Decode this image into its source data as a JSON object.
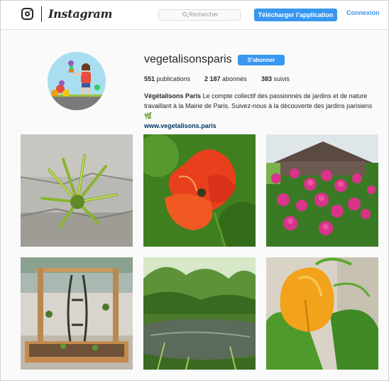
{
  "header": {
    "brand": "Instagram",
    "search_placeholder": "Rechercher",
    "download_label": "Télécharger l'application",
    "login_label": "Connexion"
  },
  "profile": {
    "username": "vegetalisonsparis",
    "follow_label": "S'abonner",
    "stats": {
      "posts_count": "551",
      "posts_label": "publications",
      "followers_count": "2 187",
      "followers_label": "abonnés",
      "following_count": "383",
      "following_label": "suivis"
    },
    "bio_name": "Végétalisons Paris",
    "bio_text": "Le compte collectif des passionnés de jardins et de nature travaillant à la Mairie de Paris. Suivez-nous à la découverte des jardins parisiens 🌿",
    "bio_link": "www.vegetalisons.paris"
  },
  "grid": {
    "posts": [
      {
        "subject": "fern in stone wall"
      },
      {
        "subject": "red poppy"
      },
      {
        "subject": "purple dahlias"
      },
      {
        "subject": "wooden planter with trellis"
      },
      {
        "subject": "garden pond"
      },
      {
        "subject": "orange squash"
      }
    ]
  },
  "colors": {
    "accent": "#3897f0",
    "link": "#003569"
  }
}
